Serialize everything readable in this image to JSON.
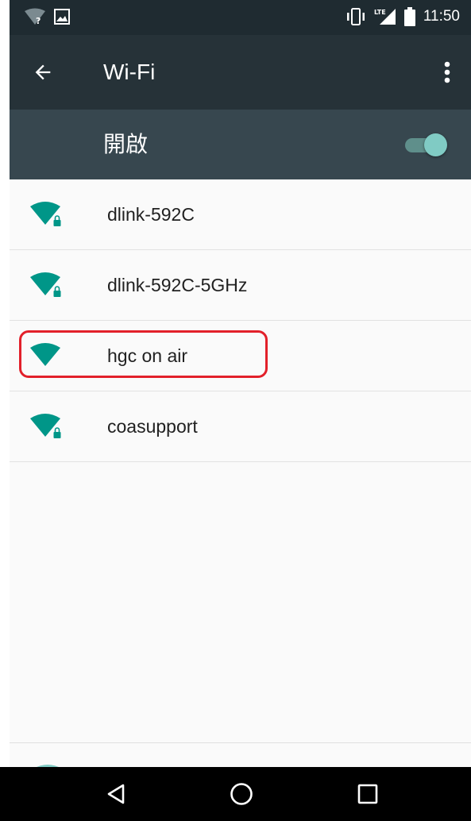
{
  "status_bar": {
    "time": "11:50",
    "network_type": "LTE",
    "icons": [
      "wifi-unknown-icon",
      "image-notification-icon",
      "vibrate-icon",
      "lte-signal-icon",
      "battery-icon"
    ]
  },
  "app_bar": {
    "title": "Wi-Fi",
    "back_icon": "arrow-back-icon",
    "menu_icon": "more-vert-icon"
  },
  "master_switch": {
    "label": "開啟",
    "on": true
  },
  "networks": [
    {
      "name": "dlink-592C",
      "secured": true
    },
    {
      "name": "dlink-592C-5GHz",
      "secured": true
    },
    {
      "name": "hgc on air",
      "secured": false,
      "highlighted": true
    },
    {
      "name": "coasupport",
      "secured": true
    }
  ],
  "nav_bar": {
    "icons": [
      "back-triangle-icon",
      "home-circle-icon",
      "recents-square-icon"
    ]
  },
  "colors": {
    "status_bar": "#1f2b31",
    "app_bar": "#263238",
    "switch_bar": "#37474f",
    "wifi_icon": "#009688",
    "toggle_thumb": "#80cbc4",
    "highlight": "#e2202a"
  }
}
